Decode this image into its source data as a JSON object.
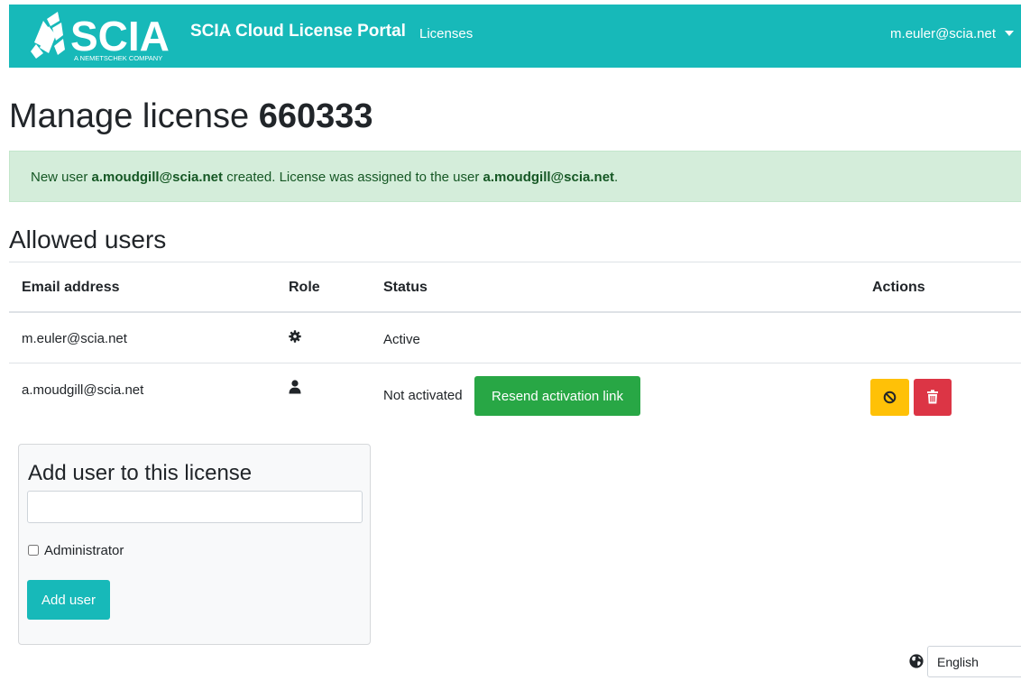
{
  "colors": {
    "brand_teal": "#17b9b9",
    "success": "#28a745",
    "warning": "#ffc107",
    "danger": "#dc3545",
    "alert_bg": "#d4edda",
    "alert_text": "#155724"
  },
  "navbar": {
    "logo_text": "SCIA",
    "logo_tagline": "A NEMETSCHEK COMPANY",
    "brand_title": "SCIA Cloud License Portal",
    "links": [
      {
        "label": "Licenses"
      }
    ],
    "user_menu_label": "m.euler@scia.net",
    "user_menu_icon": "caret-down-icon"
  },
  "page": {
    "title_prefix": "Manage license",
    "license_number": "660333"
  },
  "alert": {
    "part1": "New user ",
    "user1": "a.moudgill@scia.net",
    "part2": " created. License was assigned to the user ",
    "user2": "a.moudgill@scia.net",
    "part3": "."
  },
  "allowed_users": {
    "title": "Allowed users",
    "columns": [
      "Email address",
      "Role",
      "Status",
      "Actions"
    ],
    "rows": [
      {
        "email": "m.euler@scia.net",
        "role_icon": "gear-icon",
        "status": "Active"
      },
      {
        "email": "a.moudgill@scia.net",
        "role_icon": "user-icon",
        "status": "Not activated",
        "resend_label": "Resend activation link",
        "actions": [
          "block-icon",
          "trash-icon"
        ]
      }
    ]
  },
  "add_user": {
    "title": "Add user to this license",
    "email_value": "",
    "admin_label": "Administrator",
    "admin_checked": false,
    "submit_label": "Add user"
  },
  "language": {
    "icon": "globe-icon",
    "selected": "English"
  }
}
